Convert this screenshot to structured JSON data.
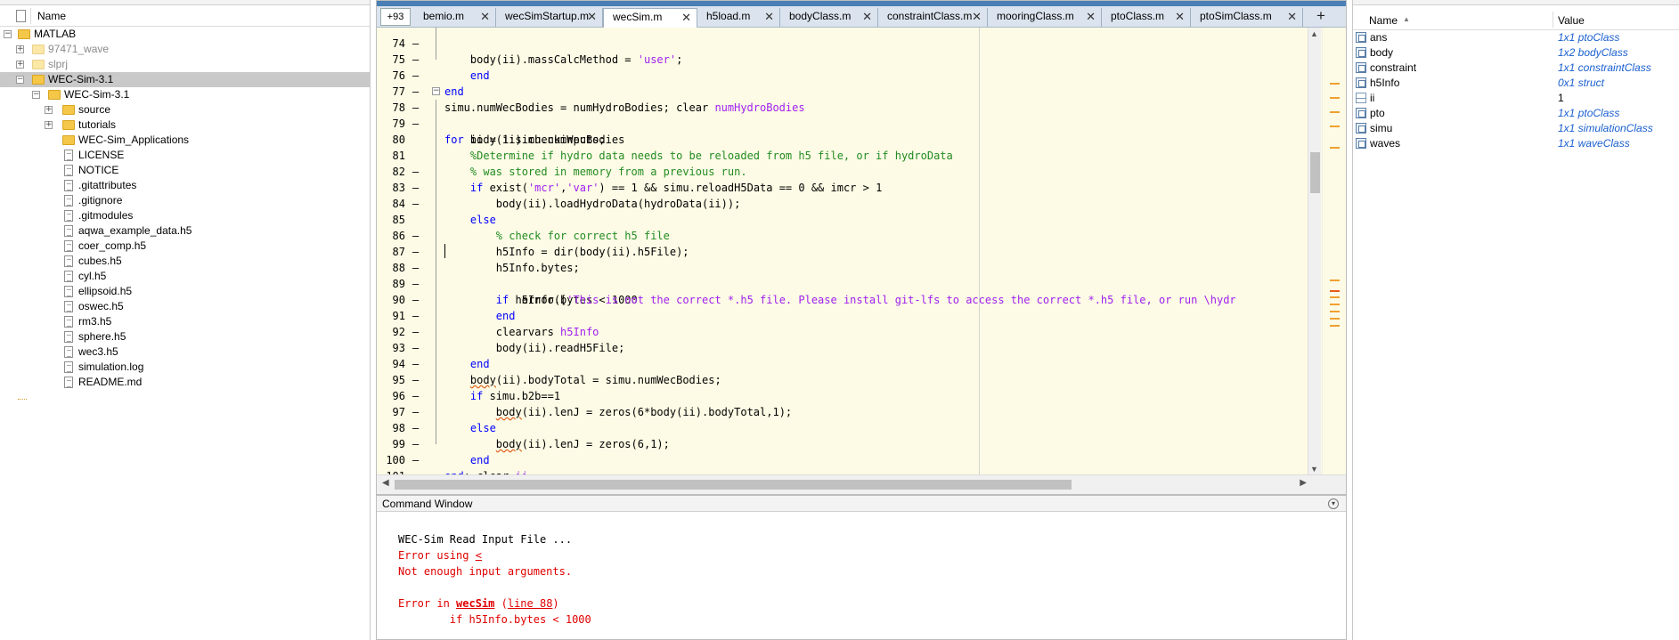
{
  "current_folder": {
    "column_name": "Name",
    "items": [
      {
        "label": "MATLAB",
        "expander": "−",
        "gray": false,
        "selected": false
      },
      {
        "label": "97471_wave",
        "expander": "+",
        "gray": true,
        "selected": false
      },
      {
        "label": "slprj",
        "expander": "+",
        "gray": true,
        "selected": false
      },
      {
        "label": "WEC-Sim-3.1",
        "expander": "−",
        "gray": false,
        "selected": true
      },
      {
        "label": "WEC-Sim-3.1",
        "expander": "−",
        "gray": false,
        "selected": false
      },
      {
        "label": "source",
        "expander": "+",
        "gray": false,
        "selected": false
      },
      {
        "label": "tutorials",
        "expander": "+",
        "gray": false,
        "selected": false
      },
      {
        "label": "WEC-Sim_Applications",
        "expander": "",
        "gray": false,
        "selected": false
      },
      {
        "label": "LICENSE"
      },
      {
        "label": "NOTICE"
      },
      {
        "label": ".gitattributes"
      },
      {
        "label": ".gitignore"
      },
      {
        "label": ".gitmodules"
      },
      {
        "label": "aqwa_example_data.h5"
      },
      {
        "label": "coer_comp.h5"
      },
      {
        "label": "cubes.h5"
      },
      {
        "label": "cyl.h5"
      },
      {
        "label": "ellipsoid.h5"
      },
      {
        "label": "oswec.h5"
      },
      {
        "label": "rm3.h5"
      },
      {
        "label": "sphere.h5"
      },
      {
        "label": "wec3.h5"
      },
      {
        "label": "simulation.log"
      },
      {
        "label": "README.md"
      }
    ]
  },
  "editor": {
    "overflow_tab": "+93",
    "tabs": [
      {
        "label": "bemio.m",
        "active": false
      },
      {
        "label": "wecSimStartup.m",
        "active": false
      },
      {
        "label": "wecSim.m",
        "active": true
      },
      {
        "label": "h5load.m",
        "active": false
      },
      {
        "label": "bodyClass.m",
        "active": false
      },
      {
        "label": "constraintClass.m",
        "active": false
      },
      {
        "label": "mooringClass.m",
        "active": false
      },
      {
        "label": "ptoClass.m",
        "active": false
      },
      {
        "label": "ptoSimClass.m",
        "active": false
      }
    ],
    "add_tab": "+",
    "close_glyph": "✕"
  },
  "command_window": {
    "title": "Command Window",
    "lines": [
      {
        "text": "WEC-Sim Read Input File ...",
        "kind": "normal"
      },
      {
        "text": "Error using ",
        "link": "<",
        "kind": "error"
      },
      {
        "text": "Not enough input arguments.",
        "kind": "error"
      },
      {
        "text": "",
        "kind": "blank"
      },
      {
        "text": "Error in ",
        "link": "wecSim",
        "link2": "line 88",
        "kind": "error-trace"
      },
      {
        "text": "        if h5Info.bytes < 1000",
        "kind": "error"
      }
    ]
  },
  "workspace": {
    "col_name": "Name",
    "col_value": "Value",
    "sort_glyph": "▲",
    "vars": [
      {
        "name": "ans",
        "value": "1x1 ptoClass",
        "plain": false
      },
      {
        "name": "body",
        "value": "1x2 bodyClass",
        "plain": false
      },
      {
        "name": "constraint",
        "value": "1x1 constraintClass",
        "plain": false
      },
      {
        "name": "h5Info",
        "value": "0x1 struct",
        "plain": false
      },
      {
        "name": "ii",
        "value": "1",
        "plain": true
      },
      {
        "name": "pto",
        "value": "1x1 ptoClass",
        "plain": false
      },
      {
        "name": "simu",
        "value": "1x1 simulationClass",
        "plain": false
      },
      {
        "name": "waves",
        "value": "1x1 waveClass",
        "plain": false
      }
    ]
  },
  "colors": {
    "keyword": "#0000ff",
    "comment": "#228b22",
    "string": "#a020f0",
    "error": "#e00000",
    "workspace_value": "#1a5fd0",
    "editor_bg": "#fdfbe5"
  }
}
